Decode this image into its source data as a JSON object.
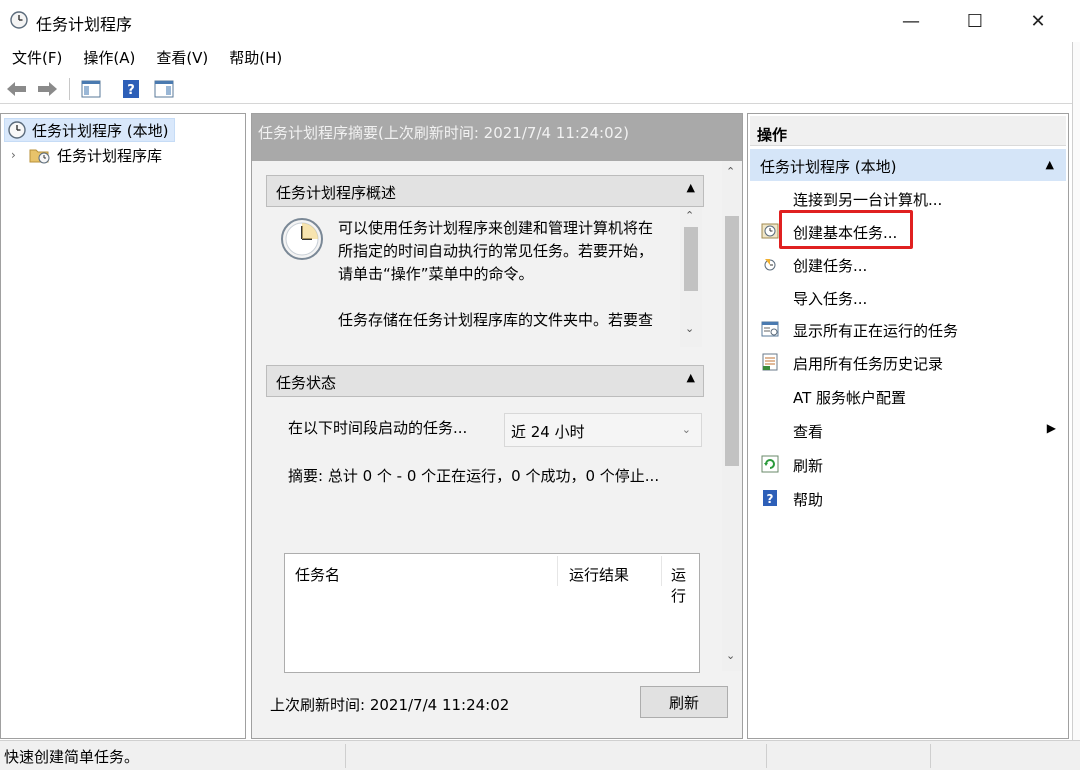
{
  "window": {
    "title": "任务计划程序",
    "controls": {
      "minimize": "—",
      "maximize": "☐",
      "close": "✕"
    }
  },
  "menu": {
    "items": [
      "文件(F)",
      "操作(A)",
      "查看(V)",
      "帮助(H)"
    ]
  },
  "toolbar": {
    "buttons": [
      "back-arrow-icon",
      "forward-arrow-icon",
      "show-hide-console-tree-icon",
      "help-icon",
      "show-hide-action-pane-icon"
    ]
  },
  "tree": {
    "root": "任务计划程序 (本地)",
    "children": [
      "任务计划程序库"
    ]
  },
  "center": {
    "header": "任务计划程序摘要(上次刷新时间: 2021/7/4 11:24:02)",
    "overview": {
      "title": "任务计划程序概述",
      "paragraph1": "可以使用任务计划程序来创建和管理计算机将在所指定的时间自动执行的常见任务。若要开始，请单击“操作”菜单中的命令。",
      "paragraph2": "任务存储在任务计划程序库的文件夹中。若要查看单独任务上的操作或执行该操作，请"
    },
    "status": {
      "title": "任务状态",
      "period_label": "在以下时间段启动的任务...",
      "period_value": "近 24 小时",
      "summary": "摘要: 总计 0 个 - 0 个正在运行，0 个成功，0 个停止..."
    },
    "table": {
      "columns": [
        "任务名",
        "运行结果",
        "运行"
      ]
    },
    "footer": {
      "last_refresh": "上次刷新时间: 2021/7/4 11:24:02",
      "refresh_button": "刷新"
    }
  },
  "actions": {
    "header": "操作",
    "group": "任务计划程序 (本地)",
    "items": [
      {
        "label": "连接到另一台计算机...",
        "icon": ""
      },
      {
        "label": "创建基本任务...",
        "icon": "create-basic-task-icon"
      },
      {
        "label": "创建任务...",
        "icon": "create-task-icon"
      },
      {
        "label": "导入任务...",
        "icon": ""
      },
      {
        "label": "显示所有正在运行的任务",
        "icon": "running-tasks-icon"
      },
      {
        "label": "启用所有任务历史记录",
        "icon": "history-icon"
      },
      {
        "label": "AT 服务帐户配置",
        "icon": ""
      },
      {
        "label": "查看",
        "icon": "",
        "submenu": true
      },
      {
        "label": "刷新",
        "icon": "refresh-icon"
      },
      {
        "label": "帮助",
        "icon": "help-icon"
      }
    ]
  },
  "statusbar": {
    "text": "快速创建简单任务。"
  },
  "colors": {
    "highlight_border": "#e02020",
    "selection_bg": "#d9e8fb",
    "group_bg": "#d5e5f8",
    "summary_header_bg": "#a9a9a9"
  }
}
